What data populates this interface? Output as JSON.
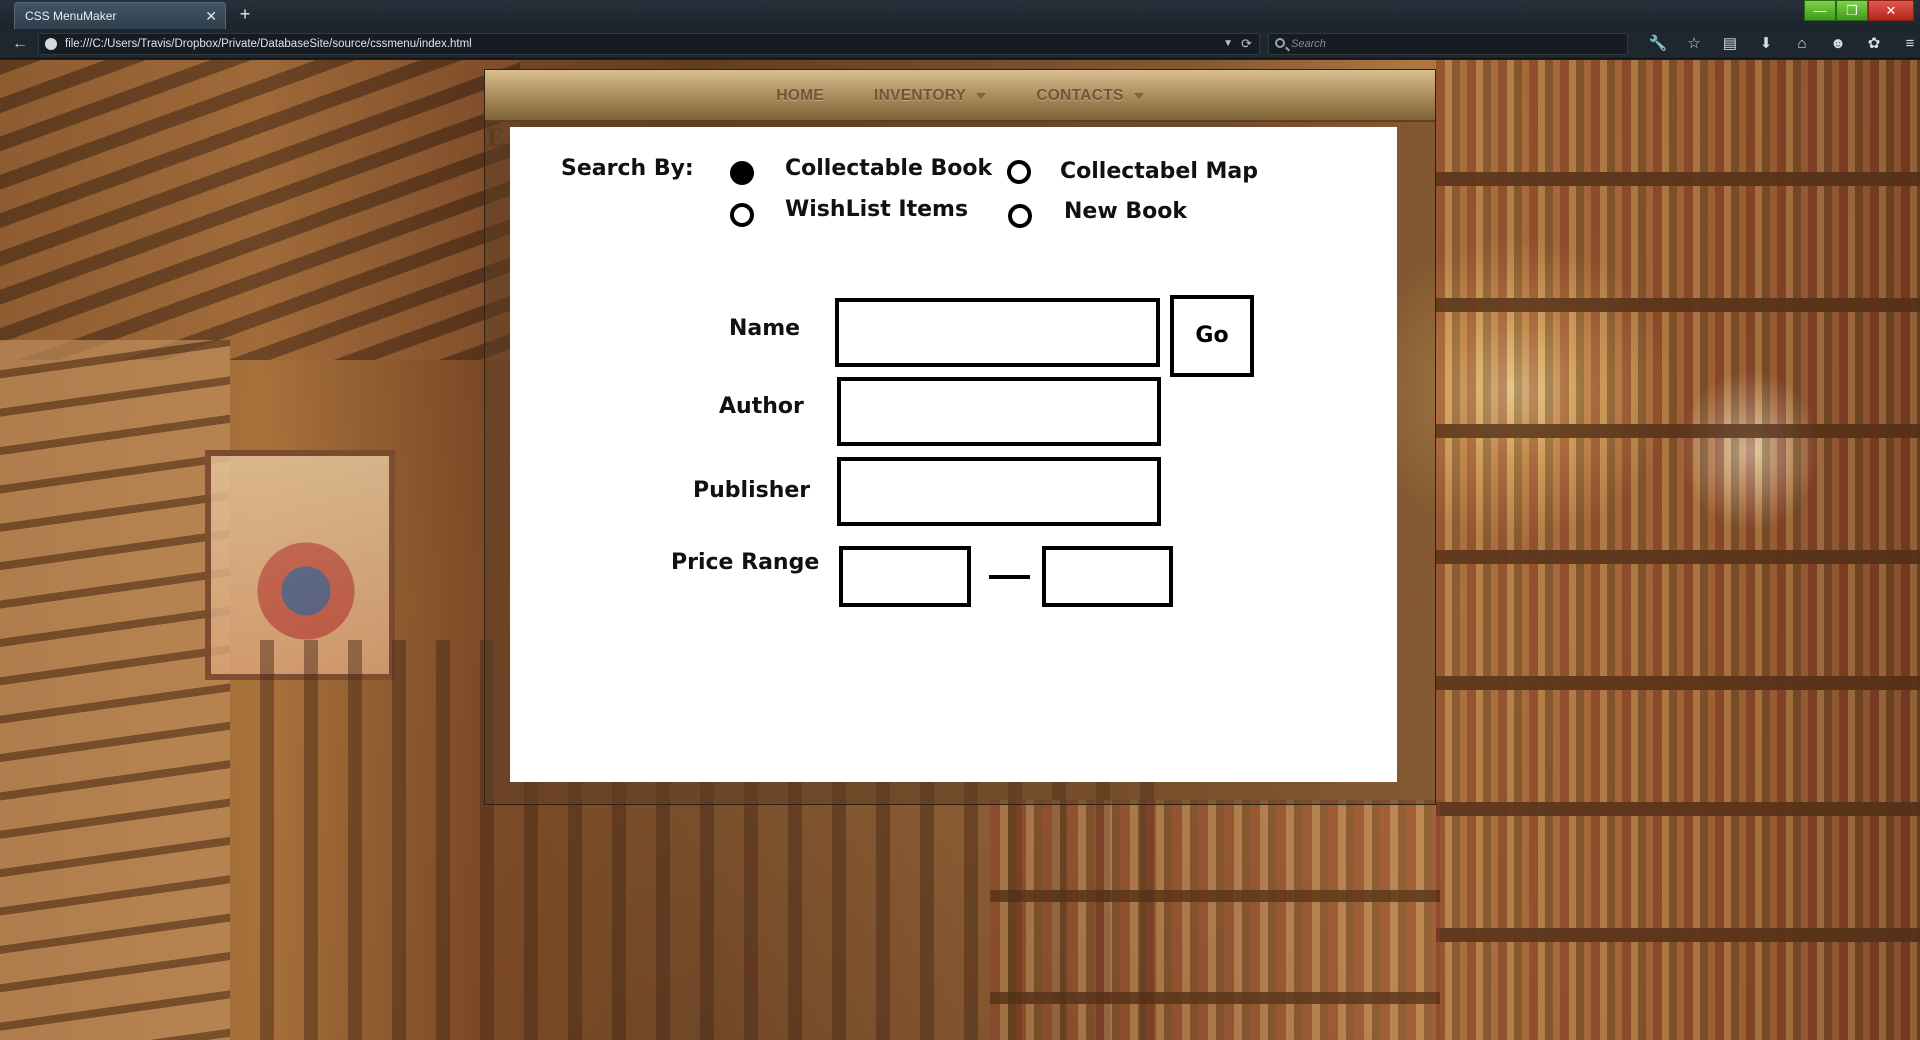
{
  "browser": {
    "tab_title": "CSS MenuMaker",
    "tab_close": "✕",
    "new_tab": "+",
    "back": "←",
    "url": "file:///C:/Users/Travis/Dropbox/Private/DatabaseSite/source/cssmenu/index.html",
    "url_dropdown": "▼",
    "reload": "⟳",
    "search_placeholder": "Search",
    "window_controls": {
      "minimize": "—",
      "maximize": "❐",
      "close": "✕"
    },
    "toolbar_icons": [
      "wrench-icon",
      "star-icon",
      "reading-list-icon",
      "download-icon",
      "home-icon",
      "chat-icon",
      "addon-icon",
      "menu-icon"
    ],
    "toolbar_glyphs": [
      "🔧",
      "☆",
      "▤",
      "⬇",
      "⌂",
      "☻",
      "✿",
      "≡"
    ]
  },
  "site": {
    "menu": [
      {
        "label": "HOME",
        "has_dropdown": false
      },
      {
        "label": "INVENTORY",
        "has_dropdown": true
      },
      {
        "label": "CONTACTS",
        "has_dropdown": true
      }
    ],
    "hidden_heading": "E"
  },
  "form": {
    "search_by_label": "Search By:",
    "options": [
      {
        "label": "Collectable Book",
        "checked": true
      },
      {
        "label": "Collectabel Map",
        "checked": false
      },
      {
        "label": "WishList Items",
        "checked": false
      },
      {
        "label": "New Book",
        "checked": false
      }
    ],
    "fields": {
      "name_label": "Name",
      "author_label": "Author",
      "publisher_label": "Publisher",
      "price_range_label": "Price Range",
      "name_value": "",
      "author_value": "",
      "publisher_value": "",
      "price_min_value": "",
      "price_max_value": ""
    },
    "go_label": "Go"
  },
  "colors": {
    "menu_text": "#6e5638",
    "panel": "#ffffff",
    "form_border": "#000000"
  }
}
